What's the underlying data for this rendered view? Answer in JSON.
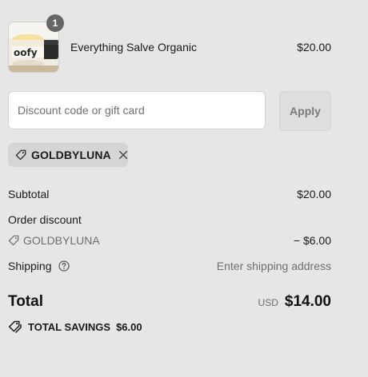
{
  "line_item": {
    "quantity": "1",
    "name": "Everything Salve Organic",
    "price": "$20.00",
    "thumb_brand_text": "oofy"
  },
  "discount": {
    "placeholder": "Discount code or gift card",
    "value": "",
    "apply_label": "Apply"
  },
  "applied_code": {
    "code": "GOLDBYLUNA",
    "icon": "tag-icon",
    "remove_icon": "close-icon"
  },
  "summary": {
    "subtotal_label": "Subtotal",
    "subtotal_value": "$20.00",
    "order_discount_label": "Order discount",
    "discount_code": "GOLDBYLUNA",
    "discount_value": "− $6.00",
    "shipping_label": "Shipping",
    "shipping_value": "Enter shipping address",
    "total_label": "Total",
    "currency": "USD",
    "total_value": "$14.00",
    "savings_label": "TOTAL SAVINGS",
    "savings_value": "$6.00"
  },
  "colors": {
    "background": "#e6e6e6",
    "badge": "#666666",
    "chip": "#d5d5d5",
    "muted_text": "#6e6e6e"
  }
}
